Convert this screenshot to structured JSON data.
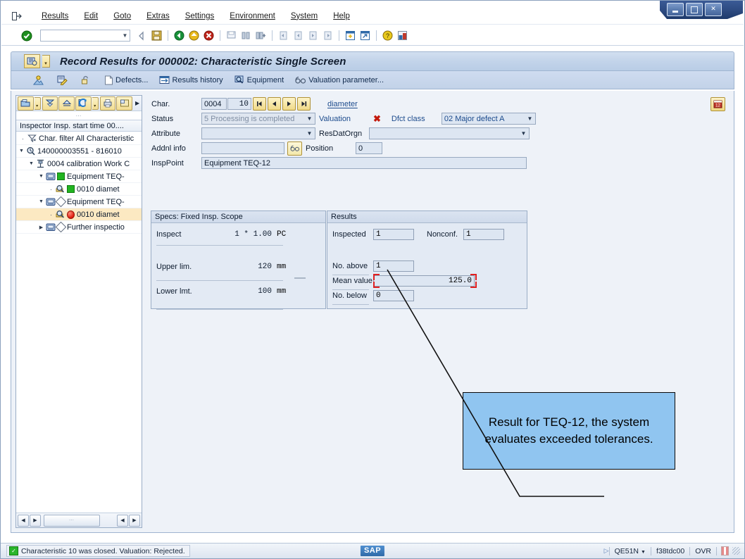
{
  "window": {
    "controls": [
      {
        "name": "minimize",
        "glyph": "_"
      },
      {
        "name": "maximize",
        "glyph": "□"
      },
      {
        "name": "close",
        "glyph": "✕"
      }
    ]
  },
  "menubar": {
    "exit_icon": "↦",
    "items": [
      {
        "label": "Results",
        "accel": "R"
      },
      {
        "label": "Edit",
        "accel": "E"
      },
      {
        "label": "Goto",
        "accel": "G"
      },
      {
        "label": "Extras",
        "accel": "a"
      },
      {
        "label": "Settings",
        "accel": "S"
      },
      {
        "label": "Environment",
        "accel": "n"
      },
      {
        "label": "System",
        "accel": "y"
      },
      {
        "label": "Help",
        "accel": "H"
      }
    ]
  },
  "toolbar": {
    "command_value": "",
    "command_placeholder": "",
    "icons": [
      {
        "name": "enter-check-icon",
        "glyph": "✔",
        "color": "#1f8f1f"
      },
      {
        "name": "back-icon",
        "glyph": "◁",
        "color": "#8896ab"
      },
      {
        "name": "save-icon",
        "glyph": "▣",
        "color": "#c9a227"
      },
      {
        "name": "back-green-icon",
        "glyph": "◀",
        "color": "#1f8f3f"
      },
      {
        "name": "exit-yellow-icon",
        "glyph": "▲",
        "color": "#e0b020"
      },
      {
        "name": "cancel-red-icon",
        "glyph": "✖",
        "color": "#c0392b"
      },
      {
        "name": "print-icon",
        "glyph": "⎙",
        "color": "#9fb0c6"
      },
      {
        "name": "find-icon",
        "glyph": "⌕",
        "color": "#8fa0b8"
      },
      {
        "name": "find-next-icon",
        "glyph": "⌕",
        "color": "#8fa0b8"
      },
      {
        "name": "first-page-icon",
        "glyph": "⏮",
        "color": "#a9b8cc"
      },
      {
        "name": "previous-page-icon",
        "glyph": "⏴",
        "color": "#a9b8cc"
      },
      {
        "name": "next-page-icon",
        "glyph": "⏵",
        "color": "#a9b8cc"
      },
      {
        "name": "last-page-icon",
        "glyph": "⏭",
        "color": "#a9b8cc"
      },
      {
        "name": "create-session-icon",
        "glyph": "▦",
        "color": "#2f6aa8"
      },
      {
        "name": "shortcut-icon",
        "glyph": "↗",
        "color": "#2f6aa8"
      },
      {
        "name": "help-icon",
        "glyph": "?",
        "color": "#d8b31e"
      },
      {
        "name": "layout-menu-icon",
        "glyph": "▤",
        "color": "#7f8ea3"
      }
    ]
  },
  "title": {
    "icon": "transaction-icon",
    "text": "Record Results for 000002: Characteristic Single Screen"
  },
  "app_toolbar": {
    "buttons": [
      {
        "name": "inspector-button",
        "label": "",
        "icon": "person-mountain-icon"
      },
      {
        "name": "results-button",
        "label": "",
        "icon": "pencil-note-icon"
      },
      {
        "name": "lock-button",
        "label": "",
        "icon": "open-lock-icon"
      },
      {
        "name": "defects-button",
        "label": "Defects...",
        "icon": "document-icon"
      },
      {
        "name": "results-history-button",
        "label": "Results history",
        "icon": "history-icon"
      },
      {
        "name": "equipment-button",
        "label": "Equipment",
        "icon": "magnifier-screen-icon"
      },
      {
        "name": "valuation-parameter-button",
        "label": "Valuation parameter...",
        "icon": "glasses-icon"
      }
    ]
  },
  "tree": {
    "toolbar_buttons": [
      {
        "name": "expand-node-button",
        "icon": "folder-blue-icon",
        "has_dropdown": true
      },
      {
        "name": "collapse-all-button",
        "icon": "double-down-arrow-icon",
        "has_dropdown": false
      },
      {
        "name": "expand-up-button",
        "icon": "up-triangle-icon",
        "has_dropdown": false
      },
      {
        "name": "refresh-button",
        "icon": "refresh-icon",
        "has_dropdown": true
      },
      {
        "name": "print-tree-button",
        "icon": "printer-icon",
        "has_dropdown": false
      },
      {
        "name": "layout-button",
        "icon": "grid-icon",
        "has_dropdown": false
      }
    ],
    "more_glyph": "▶",
    "header": "Inspector Insp. start time 00....",
    "rows": [
      {
        "indent": 0,
        "marker": "dot",
        "icon": "filter-icon",
        "status": "none",
        "label": "Char. filter All Characteristic",
        "selected": false
      },
      {
        "indent": 0,
        "marker": "expanded",
        "icon": "lot-magnifier-icon",
        "status": "none",
        "label": "140000003551 - 816010",
        "selected": false
      },
      {
        "indent": 1,
        "marker": "expanded",
        "icon": "operation-icon",
        "status": "none",
        "label": "0004 calibration Work C",
        "selected": false
      },
      {
        "indent": 2,
        "marker": "expanded",
        "icon": "insp-point-icon",
        "status": "green",
        "label": "Equipment TEQ-",
        "selected": false
      },
      {
        "indent": 3,
        "marker": "dot",
        "icon": "char-magnifier-icon",
        "status": "green",
        "label": "0010 diamet",
        "selected": false
      },
      {
        "indent": 2,
        "marker": "expanded",
        "icon": "insp-point-icon",
        "status": "diamond",
        "label": "Equipment TEQ-",
        "selected": false
      },
      {
        "indent": 3,
        "marker": "dot",
        "icon": "char-magnifier-icon",
        "status": "red",
        "label": "0010 diamet",
        "selected": true
      },
      {
        "indent": 2,
        "marker": "collapsed",
        "icon": "insp-point-icon",
        "status": "diamond",
        "label": "Further inspectio",
        "selected": false
      }
    ],
    "scroll": {
      "left_glyph": "◀",
      "right_glyph": "▶",
      "thumb_glyph": "⋯"
    }
  },
  "form": {
    "char_label": "Char.",
    "char_group": "0004",
    "char_number": "10",
    "nav_buttons": [
      {
        "name": "first-characteristic-button",
        "glyph": "⏮"
      },
      {
        "name": "previous-characteristic-button",
        "glyph": "◀"
      },
      {
        "name": "next-characteristic-button",
        "glyph": "▶"
      },
      {
        "name": "last-characteristic-button",
        "glyph": "⏭"
      }
    ],
    "char_description": "diameter",
    "calendar_icon": "calendar-icon",
    "status_label": "Status",
    "status_value": "5 Processing is completed",
    "valuation_label": "Valuation",
    "valuation_mark": "✖",
    "dfct_class_label": "Dfct class",
    "dfct_class_value": "02 Major defect A",
    "attribute_label": "Attribute",
    "attribute_value": "",
    "resdatorgn_label": "ResDatOrgn",
    "resdatorgn_value": "",
    "addnl_info_label": "Addnl info",
    "addnl_info_value": "",
    "addnl_info_icon": "glasses-icon",
    "position_label": "Position",
    "position_value": "0",
    "insppoint_label": "InspPoint",
    "insppoint_value": "Equipment TEQ-12"
  },
  "specs": {
    "header": "Specs: Fixed Insp. Scope",
    "rows": [
      {
        "label": "Inspect",
        "value": "1 * 1.00",
        "unit": "PC"
      },
      {
        "label": "Upper lim.",
        "value": "120",
        "unit": "mm"
      },
      {
        "label": "Lower lmt.",
        "value": "100",
        "unit": "mm"
      }
    ]
  },
  "results": {
    "header": "Results",
    "inspected_label": "Inspected",
    "inspected_value": "1",
    "nonconf_label": "Nonconf.",
    "nonconf_value": "1",
    "no_above_label": "No. above",
    "no_above_value": "1",
    "mean_value_label": "Mean value",
    "mean_value_value": "125.0",
    "no_below_label": "No. below",
    "no_below_value": "0"
  },
  "callout": {
    "text": "Result for TEQ-12, the system evaluates exceeded tolerances.",
    "background": "#90c5f0",
    "border": "#000000"
  },
  "statusbar": {
    "message": "Characteristic 10 was closed. Valuation: Rejected.",
    "status_icon": "green-check-icon",
    "logo": "SAP",
    "play_glyph": "▷",
    "transaction": "QE51N",
    "server": "f38tdc00",
    "insert_mode": "OVR"
  },
  "colors": {
    "accent_blue": "#1b4a8c",
    "error_red": "#c31a0d",
    "ok_green": "#2bb52b",
    "callout_blue": "#90c5f0",
    "panel_bg": "#e3eaf4",
    "content_bg": "#eef2f8"
  }
}
